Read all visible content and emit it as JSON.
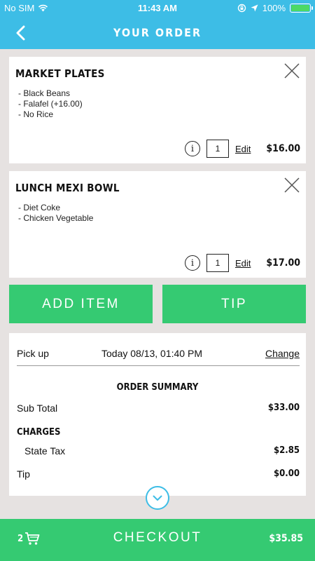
{
  "status_bar": {
    "carrier": "No SIM",
    "time": "11:43 AM",
    "battery": "100%"
  },
  "header": {
    "title": "YOUR ORDER",
    "back_icon": "chevron-left-icon"
  },
  "items": [
    {
      "name": "MARKET PLATES",
      "modifiers": [
        "- Black Beans",
        "- Falafel (+16.00)",
        "- No Rice"
      ],
      "quantity": "1",
      "edit_label": "Edit",
      "price": "$16.00"
    },
    {
      "name": "LUNCH MEXI BOWL",
      "modifiers": [
        "- Diet Coke",
        "- Chicken Vegetable"
      ],
      "quantity": "1",
      "edit_label": "Edit",
      "price": "$17.00"
    }
  ],
  "actions": {
    "add_item_label": "ADD ITEM",
    "tip_label": "TIP"
  },
  "pickup": {
    "label": "Pick up",
    "time": "Today 08/13, 01:40 PM",
    "change_label": "Change"
  },
  "summary": {
    "title": "ORDER SUMMARY",
    "subtotal_label": "Sub Total",
    "subtotal_value": "$33.00",
    "charges_label": "CHARGES",
    "state_tax_label": "State Tax",
    "state_tax_value": "$2.85",
    "tip_label": "Tip",
    "tip_value": "$0.00"
  },
  "checkout": {
    "cart_count": "2",
    "label": "CHECKOUT",
    "total": "$35.85"
  },
  "colors": {
    "accent_blue": "#3dbde6",
    "green": "#35ca72",
    "background": "#e6e2e1"
  }
}
